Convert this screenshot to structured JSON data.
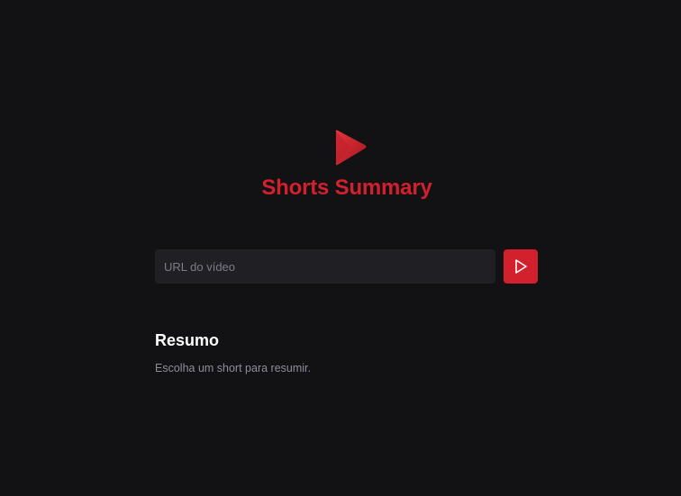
{
  "app": {
    "title": "Shorts Summary",
    "logo_icon": "play-icon",
    "brand_color": "#d3202d",
    "background_color": "#121214"
  },
  "search": {
    "value": "",
    "placeholder": "URL do vídeo",
    "submit_icon": "play-outline-icon"
  },
  "summary": {
    "heading": "Resumo",
    "text": "Escolha um short para resumir."
  }
}
